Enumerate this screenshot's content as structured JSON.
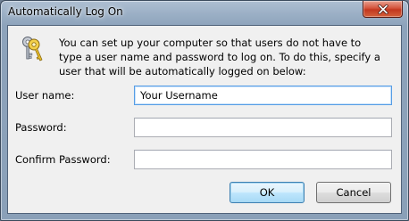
{
  "window": {
    "title": "Automatically Log On",
    "close_icon": "close-icon"
  },
  "info": {
    "icon": "keys-icon",
    "text": "You can set up your computer so that users do not have to type a user name and password to log on. To do this, specify a user that will be automatically logged on below:"
  },
  "form": {
    "username_label": "User name:",
    "username_value": "Your Username",
    "password_label": "Password:",
    "password_value": "",
    "confirm_label": "Confirm Password:",
    "confirm_value": ""
  },
  "buttons": {
    "ok_label": "OK",
    "cancel_label": "Cancel"
  },
  "colors": {
    "title_bar": "#9cb0c6",
    "client_bg": "#f0f0f0",
    "close_button": "#c3371f",
    "focus_border": "#569de5"
  }
}
